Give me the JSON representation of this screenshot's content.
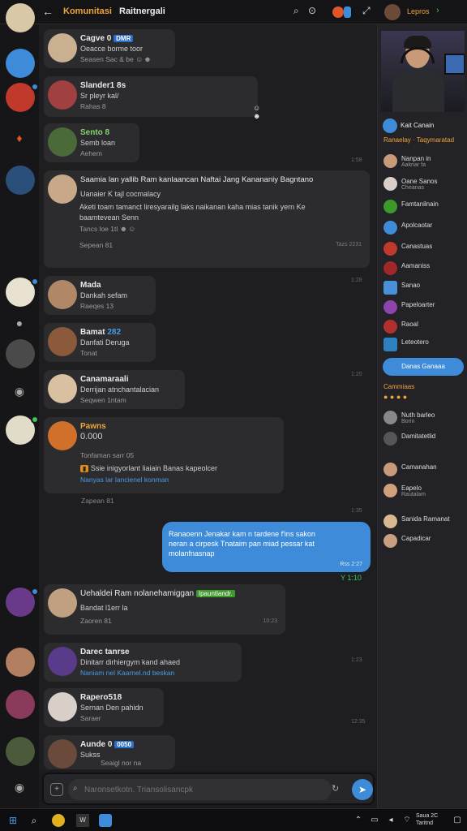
{
  "topbar": {
    "back_icon": "arrow-left-icon",
    "title": "Komunitasi",
    "subtitle": "Raitnergali",
    "user": "Lepros",
    "accent": "#f0a43a"
  },
  "messages": [
    {
      "name": "Cagve 0",
      "badge": "DMR",
      "line1": "Oeacce borme toor",
      "line2": "Seasen Sac & be",
      "time": ""
    },
    {
      "name": "Slander1 8s",
      "line1": "Sr pleyr kal/",
      "line2": "Rahas 8",
      "time": ""
    },
    {
      "name": "Sento 8",
      "line1": "Semb loan",
      "line2": "Aehem",
      "time": "1:58"
    },
    {
      "name": "Saamia lan yallib Ram kanlaancan Naftai Jang Kanananiy Bagntano",
      "line1": "Uanaier K tajl cocmalacy",
      "line2": "Aketi toam tamanct liresyarailg laks naikanan kaha mias tanik yern Ke",
      "line3": "baamtevean Senn",
      "line4": "Tancs loe 1tl",
      "footer": "Sepean 81",
      "time": "Tazs 2231"
    },
    {
      "name": "Mada",
      "line1": "Dankah sefam",
      "line2": "Raeqes 13",
      "time": "1:28"
    },
    {
      "name": "Bamat",
      "badge": "282",
      "line1": "Danfati Deruga",
      "line2": "Tonat",
      "time": ""
    },
    {
      "name": "Canamaraali",
      "line1": "Derrijan atnchantalacian",
      "line2": "Seqwen 1ntam",
      "time": "1:20"
    },
    {
      "name": "Pawns",
      "line1": "0.000",
      "line2": "Tonfaman sarr 05",
      "line3": "Ssie inigyorlant liaiain Banas kapeolcer",
      "line4": "Nanyas lar lancienel konman",
      "footer": "Zapean 81",
      "time": "1:35"
    },
    {
      "name": "Uehaldei Ram nolanehamiggan",
      "badge": "Ipauntlandr.",
      "line1": "Bandat l1err la",
      "line2": "Zaoren 81",
      "time": "10:23"
    },
    {
      "name": "Darec tanrse",
      "line1": "Dinitarr dirhiergym kand ahaed",
      "line2": "Naniam nel Kaarnel.nd beskan",
      "time": "1:23"
    },
    {
      "name": "Rapero518",
      "line1": "Sernan Den pahidn",
      "line2": "Saraer",
      "time": "12:35"
    },
    {
      "name": "Aunde 0",
      "badge": "0050",
      "line1": "Sukss",
      "line2": "Seaigl nor na",
      "time": ""
    }
  ],
  "sent_message": {
    "line1": "Ranaoenn Jenakar kam n tardene f'ins sakon",
    "line2": "neran a cirpesk Tnataim pan miad pessar kat",
    "line3": "molanfnasnap",
    "time": "Rss 2:27",
    "status": "Y 1:10"
  },
  "input": {
    "placeholder": "Naronsetkotn. Triansolisancpk"
  },
  "right_panel": {
    "header_name": "Kait Canain",
    "header_sub": "Ranaelay · Taqymaratad",
    "members": [
      {
        "name": "Nanpan in",
        "sub": "Aaknar fa",
        "color": "#c89a7a"
      },
      {
        "name": "Oane Sanos",
        "sub": "Cheanas",
        "color": "#d8d0c8"
      },
      {
        "name": "Famtanilnain",
        "sub": "",
        "color": "#3d9a2a"
      },
      {
        "name": "Apolcaotar",
        "sub": "",
        "color": "#3d8bd9"
      },
      {
        "name": "Canastuas",
        "sub": "",
        "color": "#c0392b"
      },
      {
        "name": "Aamaniss",
        "sub": "",
        "color": "#a02828"
      },
      {
        "name": "Sanao",
        "sub": "",
        "color": "#4a90d9"
      },
      {
        "name": "Papeloarter",
        "sub": "",
        "color": "#8e44ad"
      },
      {
        "name": "Raoal",
        "sub": "",
        "color": "#b03030"
      },
      {
        "name": "Leteotero",
        "sub": "",
        "color": "#2f80c0"
      }
    ],
    "button": "Danas Ganaaa",
    "group2_title": "Cammiaas",
    "group2": [
      {
        "name": "Nuth barleo",
        "sub": "Borin",
        "color": "#888"
      },
      {
        "name": "Damitatetlid",
        "sub": "",
        "color": "#555"
      },
      {
        "name": "Camanahan",
        "sub": "",
        "color": "#c89a7a"
      },
      {
        "name": "Eapelo",
        "sub": "Rautalam",
        "color": "#cfa07a"
      },
      {
        "name": "Sanida Ramanat",
        "sub": "",
        "color": "#d8b890"
      },
      {
        "name": "Capadicar",
        "sub": "",
        "color": "#c8a080"
      }
    ]
  },
  "taskbar": {
    "clock_line1": "Saua 2C",
    "clock_line2": "Taritnd"
  }
}
